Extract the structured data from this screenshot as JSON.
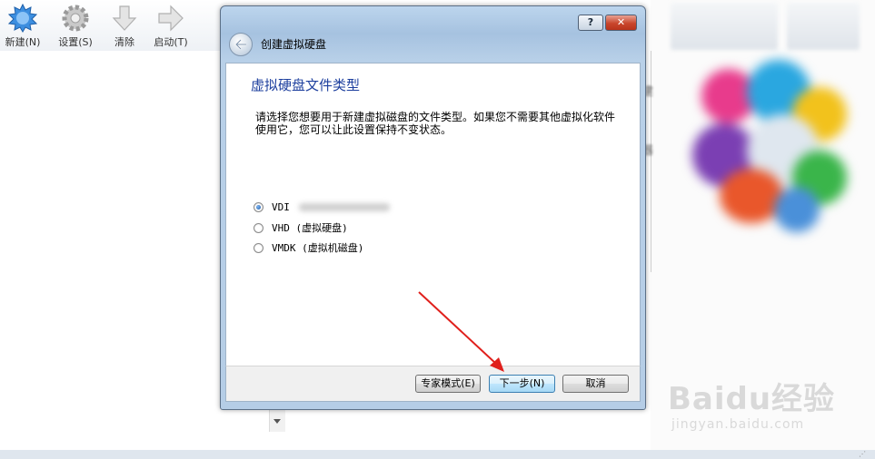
{
  "toolbar": {
    "items": [
      {
        "label": "新建(N)",
        "icon": "new-icon"
      },
      {
        "label": "设置(S)",
        "icon": "settings-gear-icon"
      },
      {
        "label": "清除",
        "icon": "discard-arrow-icon"
      },
      {
        "label": "启动(T)",
        "icon": "start-arrow-icon"
      }
    ]
  },
  "right_panel": {
    "fragments": [
      "建",
      "器"
    ]
  },
  "dialog": {
    "help_label": "?",
    "close_label": "✕",
    "title": "创建虚拟硬盘",
    "page_title": "虚拟硬盘文件类型",
    "description": "请选择您想要用于新建虚拟磁盘的文件类型。如果您不需要其他虚拟化软件使用它，您可以让此设置保持不变状态。",
    "options": [
      {
        "label": "VDI",
        "checked": true
      },
      {
        "label": "VHD (虚拟硬盘)",
        "checked": false
      },
      {
        "label": "VMDK (虚拟机磁盘)",
        "checked": false
      }
    ],
    "buttons": {
      "expert": "专家模式(E)",
      "next": "下一步(N)",
      "cancel": "取消"
    }
  },
  "watermark": {
    "logo": "Baidu经验",
    "url": "jingyan.baidu.com"
  },
  "colors": {
    "title_blue": "#1d3f9e",
    "close_red": "#c9462c",
    "annotation_red": "#e0201c"
  }
}
